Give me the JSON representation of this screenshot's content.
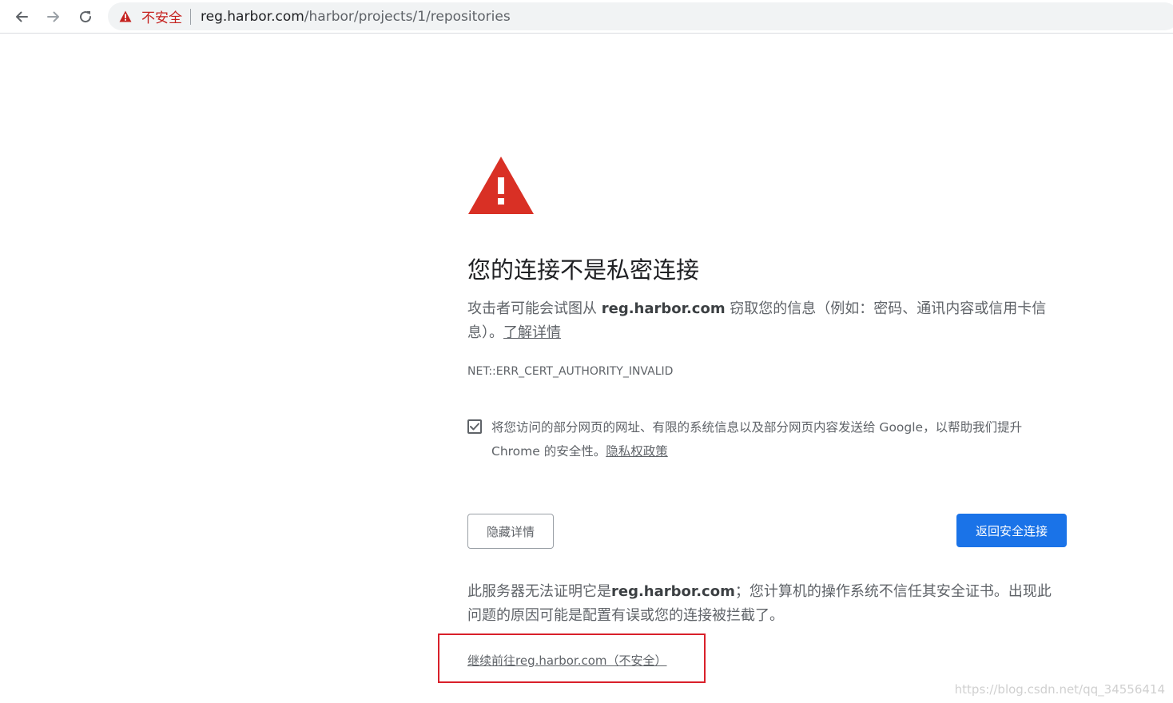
{
  "browser": {
    "security_label": "不安全",
    "url_host": "reg.harbor.com",
    "url_path": "/harbor/projects/1/repositories"
  },
  "interstitial": {
    "headline": "您的连接不是私密连接",
    "explanation_prefix": "攻击者可能会试图从 ",
    "explanation_host": "reg.harbor.com",
    "explanation_suffix": " 窃取您的信息（例如：密码、通讯内容或信用卡信息）。",
    "learn_more": "了解详情",
    "error_code": "NET::ERR_CERT_AUTHORITY_INVALID",
    "optin_text": "将您访问的部分网页的网址、有限的系统信息以及部分网页内容发送给 Google，以帮助我们提升 Chrome 的安全性。",
    "privacy_link": "隐私权政策",
    "optin_checked": true,
    "details_button": "隐藏详情",
    "back_button": "返回安全连接",
    "details_prefix": "此服务器无法证明它是",
    "details_host": "reg.harbor.com",
    "details_suffix": "；您计算机的操作系统不信任其安全证书。出现此问题的原因可能是配置有误或您的连接被拦截了。",
    "proceed_link": "继续前往reg.harbor.com（不安全）"
  },
  "watermark": "https://blog.csdn.net/qq_34556414",
  "colors": {
    "danger": "#d93025",
    "primary": "#1a73e8",
    "text_secondary": "#5f6368",
    "highlight_box": "#d9202a"
  },
  "icons": [
    "back-arrow-icon",
    "forward-arrow-icon",
    "reload-icon",
    "warning-triangle-icon",
    "checkmark-icon"
  ]
}
